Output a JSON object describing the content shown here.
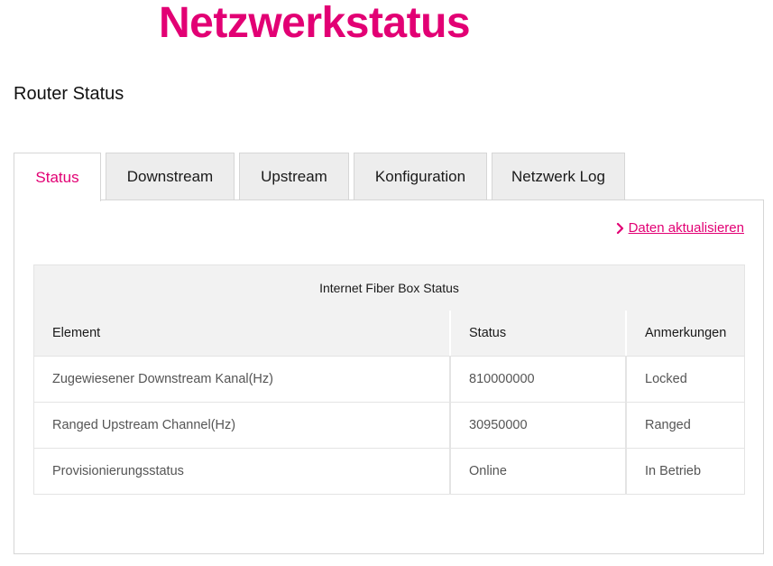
{
  "header": {
    "title": "Netzwerkstatus",
    "section_title": "Router Status"
  },
  "tabs": [
    {
      "label": "Status",
      "active": true
    },
    {
      "label": "Downstream",
      "active": false
    },
    {
      "label": "Upstream",
      "active": false
    },
    {
      "label": "Konfiguration",
      "active": false
    },
    {
      "label": "Netzwerk Log",
      "active": false
    }
  ],
  "panel": {
    "refresh_label": "Daten aktualisieren",
    "refresh_icon": "chevron-right-icon"
  },
  "table": {
    "caption": "Internet Fiber Box Status",
    "columns": [
      "Element",
      "Status",
      "Anmerkungen"
    ],
    "rows": [
      [
        "Zugewiesener Downstream Kanal(Hz)",
        "810000000",
        "Locked"
      ],
      [
        "Ranged Upstream Channel(Hz)",
        "30950000",
        "Ranged"
      ],
      [
        "Provisionierungsstatus",
        "Online",
        "In Betrieb"
      ]
    ]
  },
  "colors": {
    "brand": "#e20074",
    "tab_inactive_bg": "#ededed",
    "table_header_bg": "#f2f2f2",
    "border": "#d6d6d6"
  }
}
